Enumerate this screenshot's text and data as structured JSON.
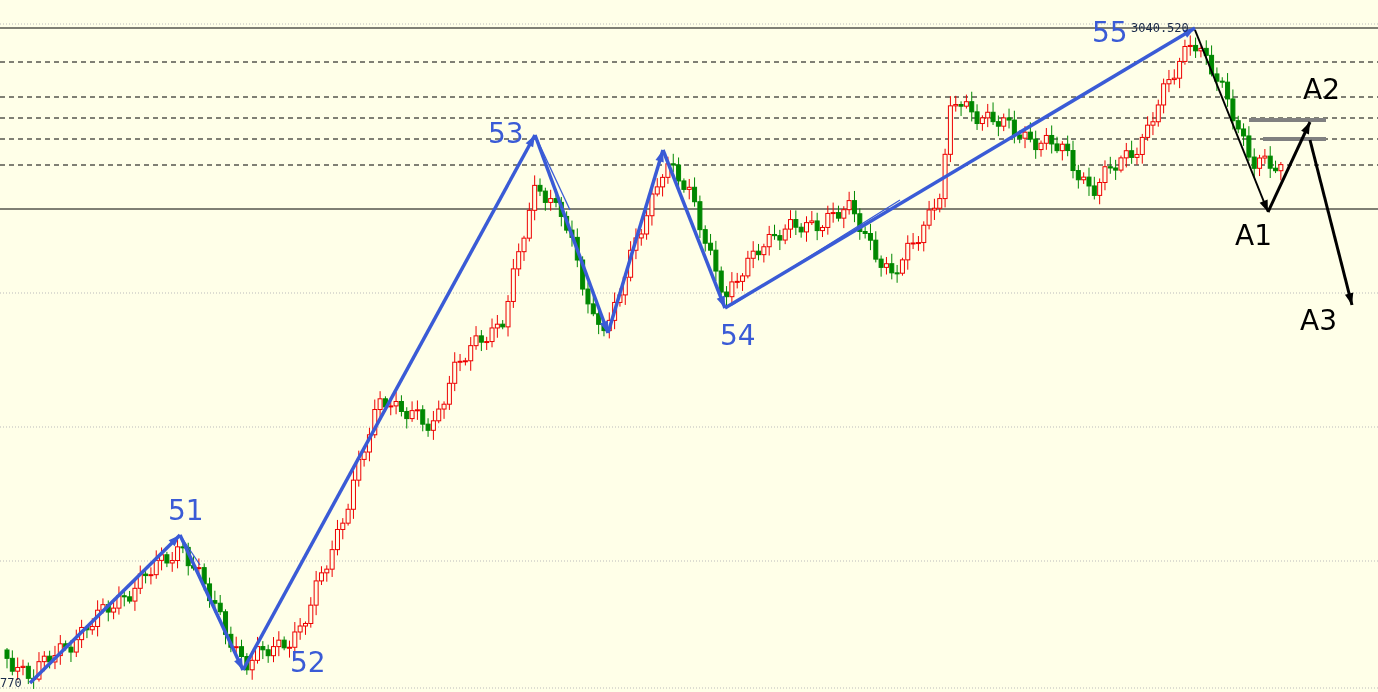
{
  "chart": {
    "kind": "candlestick",
    "wave_labels": [
      "51",
      "52",
      "53",
      "54",
      "55"
    ],
    "projection_labels": [
      "A1",
      "A2",
      "A3"
    ],
    "price_labels": [
      "3040.520",
      "770"
    ]
  }
}
